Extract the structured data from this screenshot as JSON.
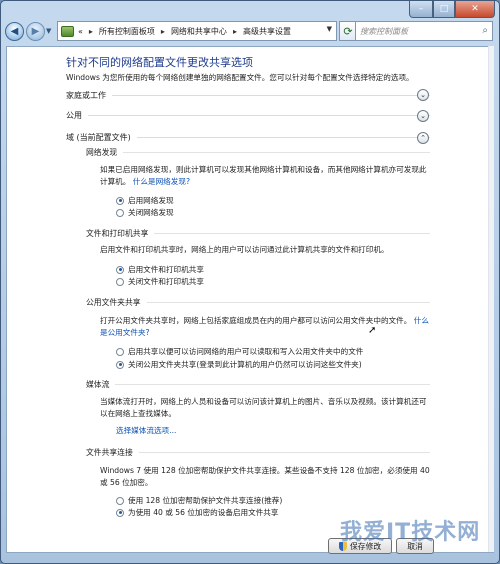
{
  "window": {
    "caption_buttons": {
      "minimize": "–",
      "maximize": "□",
      "close": "✕"
    }
  },
  "toolbar": {
    "back_icon": "back-arrow-icon",
    "forward_icon": "forward-arrow-icon",
    "address": {
      "overflow": "«",
      "crumbs": [
        "所有控制面板项",
        "网络和共享中心",
        "高级共享设置"
      ]
    },
    "search_placeholder": "搜索控制面板"
  },
  "page": {
    "title": "针对不同的网络配置文件更改共享选项",
    "description": "Windows 为您所使用的每个网络创建单独的网络配置文件。您可以针对每个配置文件选择特定的选项。",
    "profiles": [
      {
        "label": "家庭或工作",
        "expanded": false
      },
      {
        "label": "公用",
        "expanded": false
      },
      {
        "label": "域 (当前配置文件)",
        "expanded": true
      }
    ],
    "sections": {
      "network_discovery": {
        "heading": "网络发现",
        "text": "如果已启用网络发现，则此计算机可以发现其他网络计算机和设备，而其他网络计算机亦可发现此计算机。",
        "link": "什么是网络发现?",
        "options": [
          {
            "label": "启用网络发现",
            "selected": true
          },
          {
            "label": "关闭网络发现",
            "selected": false
          }
        ]
      },
      "file_printer": {
        "heading": "文件和打印机共享",
        "text": "启用文件和打印机共享时，网络上的用户可以访问通过此计算机共享的文件和打印机。",
        "options": [
          {
            "label": "启用文件和打印机共享",
            "selected": true
          },
          {
            "label": "关闭文件和打印机共享",
            "selected": false
          }
        ]
      },
      "public_folder": {
        "heading": "公用文件夹共享",
        "text": "打开公用文件夹共享时，网络上包括家庭组成员在内的用户都可以访问公用文件夹中的文件。",
        "link": "什么是公用文件夹?",
        "options": [
          {
            "label": "启用共享以便可以访问网络的用户可以读取和写入公用文件夹中的文件",
            "selected": false
          },
          {
            "label": "关闭公用文件夹共享(登录到此计算机的用户仍然可以访问这些文件夹)",
            "selected": true
          }
        ]
      },
      "media_streaming": {
        "heading": "媒体流",
        "text": "当媒体流打开时，网络上的人员和设备可以访问该计算机上的图片、音乐以及视频。该计算机还可以在网络上查找媒体。",
        "link": "选择媒体流选项..."
      },
      "file_sharing_connections": {
        "heading": "文件共享连接",
        "text": "Windows 7 使用 128 位加密帮助保护文件共享连接。某些设备不支持 128 位加密，必须使用 40 或 56 位加密。",
        "options": [
          {
            "label": "使用 128 位加密帮助保护文件共享连接(推荐)",
            "selected": false
          },
          {
            "label": "为使用 40 或 56 位加密的设备启用文件共享",
            "selected": true
          }
        ]
      }
    },
    "buttons": {
      "save": "保存修改",
      "cancel": "取消"
    },
    "watermark": "我爱IT技术网"
  },
  "colors": {
    "title": "#1e3b8c",
    "link": "#0b4fb3",
    "accent": "#1e5aa8"
  }
}
